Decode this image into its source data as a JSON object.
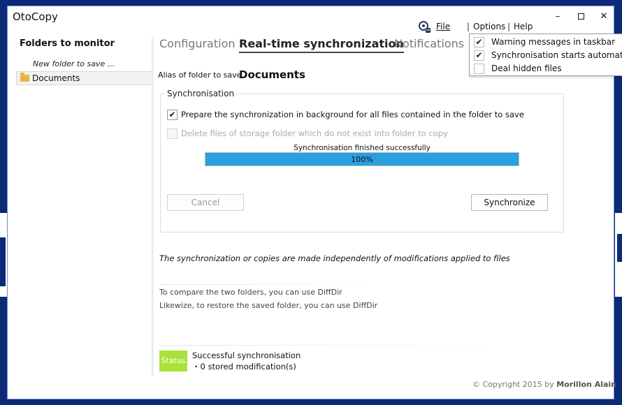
{
  "window": {
    "title": "OtoCopy",
    "controls": {
      "minimize": "–",
      "maximize": "",
      "close": "✕"
    }
  },
  "left_panel": {
    "heading": "Folders to monitor",
    "new_folder": "New folder to save ...",
    "folders": [
      {
        "label": "Documents"
      }
    ]
  },
  "tabs": [
    {
      "label": "Configuration",
      "active": false
    },
    {
      "label": "Real-time synchronization",
      "active": true
    },
    {
      "label": "Notifications",
      "active": false
    }
  ],
  "menu": {
    "file": "File",
    "options": "Options",
    "help": "Help",
    "separator": "|"
  },
  "options_dropdown": [
    {
      "label": "Warning messages in taskbar",
      "checked": true,
      "mark": "✔"
    },
    {
      "label": "Synchronisation starts automatically",
      "checked": true,
      "mark": "✔"
    },
    {
      "label": "Deal hidden files",
      "checked": false,
      "mark": ""
    }
  ],
  "alias": {
    "label": "Alias of folder to save",
    "value": "Documents"
  },
  "sync": {
    "legend": "Synchronisation",
    "prepare_label": "Prepare the synchronization in background for all files contained in the folder to save",
    "prepare_mark": "✔",
    "delete_label": "Delete files of storage folder which do not exist into folder to copy",
    "delete_mark": "",
    "progress_caption": "Synchronisation finished successfully",
    "progress_text": "100%",
    "progress_value": 1.0,
    "cancel_label": "Cancel",
    "synchronize_label": "Synchronize"
  },
  "note": "The synchronization or copies are made independently of modifications applied to files",
  "diffdir": {
    "line1": "To compare the two folders, you can use DiffDir",
    "line2": "Likewize, to restore the saved folder, you can use DiffDir"
  },
  "status": {
    "badge": "Status",
    "line1": "Successful synchronisation",
    "line2": "・0 stored modification(s)",
    "color": "#a9e23a"
  },
  "copyright": {
    "prefix": "© Copyright 2015 by ",
    "author": "Morillon Alain"
  },
  "colors": {
    "accent": "#2a9fe0",
    "desktop": "#0d2a78",
    "folder": "#e8b447"
  }
}
